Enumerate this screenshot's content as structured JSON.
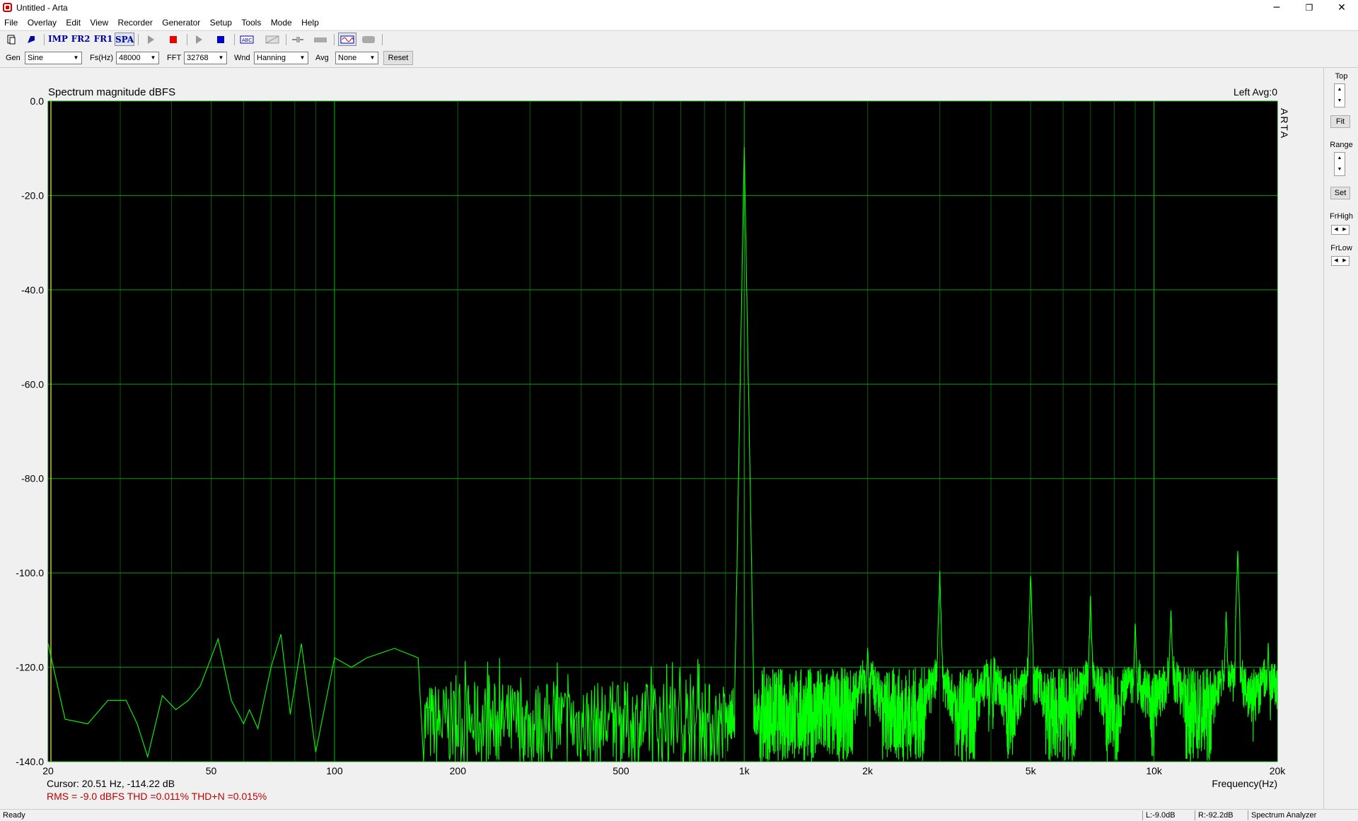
{
  "window": {
    "title": "Untitled - Arta",
    "minimize": "─",
    "restore": "❐",
    "close": "✕"
  },
  "menu": [
    "File",
    "Overlay",
    "Edit",
    "View",
    "Recorder",
    "Generator",
    "Setup",
    "Tools",
    "Mode",
    "Help"
  ],
  "toolbar": {
    "imp": "IMP",
    "fr2": "FR2",
    "fr1": "FR1",
    "spa": "SPA"
  },
  "params": {
    "gen_label": "Gen",
    "gen_value": "Sine",
    "fs_label": "Fs(Hz)",
    "fs_value": "48000",
    "fft_label": "FFT",
    "fft_value": "32768",
    "wnd_label": "Wnd",
    "wnd_value": "Hanning",
    "avg_label": "Avg",
    "avg_value": "None",
    "reset_label": "Reset"
  },
  "sidebar": {
    "top": "Top",
    "fit": "Fit",
    "range": "Range",
    "set": "Set",
    "frhigh": "FrHigh",
    "frlow": "FrLow"
  },
  "chart_data": {
    "type": "line",
    "title": "Spectrum magnitude dBFS",
    "channel_info": "Left  Avg:0",
    "watermark": "ARTA",
    "xlabel": "Frequency(Hz)",
    "xscale": "log",
    "xlim": [
      20,
      20000
    ],
    "ylim": [
      -140,
      0
    ],
    "x_ticks": [
      "20",
      "50",
      "100",
      "200",
      "500",
      "1k",
      "2k",
      "5k",
      "10k",
      "20k"
    ],
    "y_ticks": [
      "0.0",
      "-20.0",
      "-40.0",
      "-60.0",
      "-80.0",
      "-100.0",
      "-120.0",
      "-140.0"
    ],
    "grid": true,
    "colors": {
      "background": "#000000",
      "grid": "#00a000",
      "trace": "#00ff00"
    },
    "series": [
      {
        "fundamental_hz": 1000,
        "fundamental_db": -9.7,
        "harmonics": [
          [
            2000,
            -115
          ],
          [
            3000,
            -100
          ],
          [
            4000,
            -118
          ],
          [
            5000,
            -100
          ],
          [
            7000,
            -105
          ],
          [
            9000,
            -110
          ],
          [
            11000,
            -107
          ],
          [
            15000,
            -108
          ],
          [
            16000,
            -95
          ],
          [
            19000,
            -115
          ]
        ],
        "low_freq_points": [
          [
            20,
            -115
          ],
          [
            22,
            -131
          ],
          [
            25,
            -132
          ],
          [
            28,
            -127
          ],
          [
            31,
            -127
          ],
          [
            33,
            -132
          ],
          [
            35,
            -139
          ],
          [
            38,
            -126
          ],
          [
            41,
            -129
          ],
          [
            44,
            -127
          ],
          [
            47,
            -124
          ],
          [
            50,
            -118
          ],
          [
            52,
            -114
          ],
          [
            56,
            -127
          ],
          [
            60,
            -132
          ],
          [
            62,
            -129
          ],
          [
            65,
            -133
          ],
          [
            70,
            -120
          ],
          [
            74,
            -113
          ],
          [
            78,
            -130
          ],
          [
            83,
            -115
          ],
          [
            90,
            -138
          ],
          [
            100,
            -118
          ],
          [
            110,
            -120
          ],
          [
            120,
            -118
          ],
          [
            140,
            -116
          ],
          [
            160,
            -118
          ]
        ],
        "noise_floor_db_low": -132,
        "noise_floor_db_high": -130
      }
    ]
  },
  "readout": {
    "cursor": "Cursor: 20.51 Hz, -114.22 dB",
    "rms": "RMS =   -9.0 dBFS   THD =0.011%   THD+N =0.015%"
  },
  "status": {
    "ready": "Ready",
    "left_level": "L:-9.0dB",
    "right_level": "R:-92.2dB",
    "mode": "Spectrum Analyzer"
  }
}
